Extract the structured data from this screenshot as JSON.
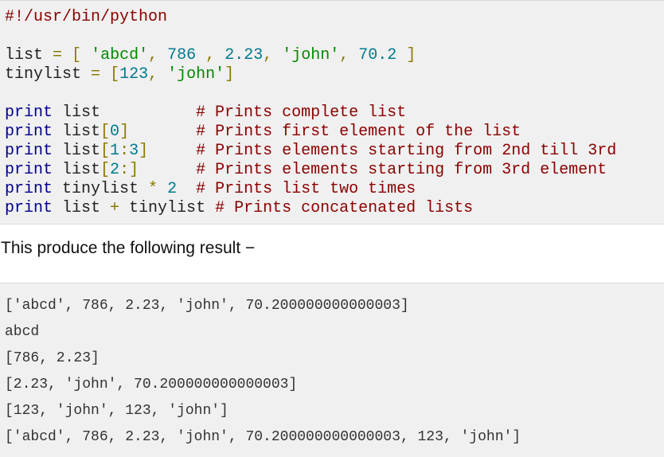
{
  "code_lines": [
    [
      {
        "t": "shebang",
        "v": "#!/usr/bin/python"
      }
    ],
    [
      {
        "t": "plain",
        "v": ""
      }
    ],
    [
      {
        "t": "plain",
        "v": "list "
      },
      {
        "t": "op",
        "v": "="
      },
      {
        "t": "plain",
        "v": " "
      },
      {
        "t": "punct",
        "v": "["
      },
      {
        "t": "plain",
        "v": " "
      },
      {
        "t": "string",
        "v": "'abcd'"
      },
      {
        "t": "punct",
        "v": ","
      },
      {
        "t": "plain",
        "v": " "
      },
      {
        "t": "number",
        "v": "786"
      },
      {
        "t": "plain",
        "v": " "
      },
      {
        "t": "punct",
        "v": ","
      },
      {
        "t": "plain",
        "v": " "
      },
      {
        "t": "number",
        "v": "2.23"
      },
      {
        "t": "punct",
        "v": ","
      },
      {
        "t": "plain",
        "v": " "
      },
      {
        "t": "string",
        "v": "'john'"
      },
      {
        "t": "punct",
        "v": ","
      },
      {
        "t": "plain",
        "v": " "
      },
      {
        "t": "number",
        "v": "70.2"
      },
      {
        "t": "plain",
        "v": " "
      },
      {
        "t": "punct",
        "v": "]"
      }
    ],
    [
      {
        "t": "plain",
        "v": "tinylist "
      },
      {
        "t": "op",
        "v": "="
      },
      {
        "t": "plain",
        "v": " "
      },
      {
        "t": "punct",
        "v": "["
      },
      {
        "t": "number",
        "v": "123"
      },
      {
        "t": "punct",
        "v": ","
      },
      {
        "t": "plain",
        "v": " "
      },
      {
        "t": "string",
        "v": "'john'"
      },
      {
        "t": "punct",
        "v": "]"
      }
    ],
    [
      {
        "t": "plain",
        "v": ""
      }
    ],
    [
      {
        "t": "keyword",
        "v": "print"
      },
      {
        "t": "plain",
        "v": " list          "
      },
      {
        "t": "comment",
        "v": "# Prints complete list"
      }
    ],
    [
      {
        "t": "keyword",
        "v": "print"
      },
      {
        "t": "plain",
        "v": " list"
      },
      {
        "t": "punct",
        "v": "["
      },
      {
        "t": "number",
        "v": "0"
      },
      {
        "t": "punct",
        "v": "]"
      },
      {
        "t": "plain",
        "v": "       "
      },
      {
        "t": "comment",
        "v": "# Prints first element of the list"
      }
    ],
    [
      {
        "t": "keyword",
        "v": "print"
      },
      {
        "t": "plain",
        "v": " list"
      },
      {
        "t": "punct",
        "v": "["
      },
      {
        "t": "number",
        "v": "1"
      },
      {
        "t": "punct",
        "v": ":"
      },
      {
        "t": "number",
        "v": "3"
      },
      {
        "t": "punct",
        "v": "]"
      },
      {
        "t": "plain",
        "v": "     "
      },
      {
        "t": "comment",
        "v": "# Prints elements starting from 2nd till 3rd"
      }
    ],
    [
      {
        "t": "keyword",
        "v": "print"
      },
      {
        "t": "plain",
        "v": " list"
      },
      {
        "t": "punct",
        "v": "["
      },
      {
        "t": "number",
        "v": "2"
      },
      {
        "t": "punct",
        "v": ":]"
      },
      {
        "t": "plain",
        "v": "      "
      },
      {
        "t": "comment",
        "v": "# Prints elements starting from 3rd element"
      }
    ],
    [
      {
        "t": "keyword",
        "v": "print"
      },
      {
        "t": "plain",
        "v": " tinylist "
      },
      {
        "t": "op",
        "v": "*"
      },
      {
        "t": "plain",
        "v": " "
      },
      {
        "t": "number",
        "v": "2"
      },
      {
        "t": "plain",
        "v": "  "
      },
      {
        "t": "comment",
        "v": "# Prints list two times"
      }
    ],
    [
      {
        "t": "keyword",
        "v": "print"
      },
      {
        "t": "plain",
        "v": " list "
      },
      {
        "t": "op",
        "v": "+"
      },
      {
        "t": "plain",
        "v": " tinylist "
      },
      {
        "t": "comment",
        "v": "# Prints concatenated lists"
      }
    ]
  ],
  "paragraph": "This produce the following result −",
  "output_lines": [
    "['abcd', 786, 2.23, 'john', 70.200000000000003]",
    "abcd",
    "[786, 2.23]",
    "[2.23, 'john', 70.200000000000003]",
    "[123, 'john', 123, 'john']",
    "['abcd', 786, 2.23, 'john', 70.200000000000003, 123, 'john']"
  ]
}
